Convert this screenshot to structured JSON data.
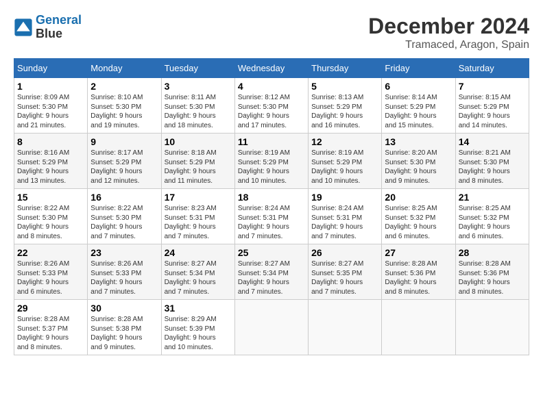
{
  "logo": {
    "line1": "General",
    "line2": "Blue"
  },
  "title": "December 2024",
  "location": "Tramaced, Aragon, Spain",
  "headers": [
    "Sunday",
    "Monday",
    "Tuesday",
    "Wednesday",
    "Thursday",
    "Friday",
    "Saturday"
  ],
  "weeks": [
    [
      {
        "day": "1",
        "info": "Sunrise: 8:09 AM\nSunset: 5:30 PM\nDaylight: 9 hours\nand 21 minutes."
      },
      {
        "day": "2",
        "info": "Sunrise: 8:10 AM\nSunset: 5:30 PM\nDaylight: 9 hours\nand 19 minutes."
      },
      {
        "day": "3",
        "info": "Sunrise: 8:11 AM\nSunset: 5:30 PM\nDaylight: 9 hours\nand 18 minutes."
      },
      {
        "day": "4",
        "info": "Sunrise: 8:12 AM\nSunset: 5:30 PM\nDaylight: 9 hours\nand 17 minutes."
      },
      {
        "day": "5",
        "info": "Sunrise: 8:13 AM\nSunset: 5:29 PM\nDaylight: 9 hours\nand 16 minutes."
      },
      {
        "day": "6",
        "info": "Sunrise: 8:14 AM\nSunset: 5:29 PM\nDaylight: 9 hours\nand 15 minutes."
      },
      {
        "day": "7",
        "info": "Sunrise: 8:15 AM\nSunset: 5:29 PM\nDaylight: 9 hours\nand 14 minutes."
      }
    ],
    [
      {
        "day": "8",
        "info": "Sunrise: 8:16 AM\nSunset: 5:29 PM\nDaylight: 9 hours\nand 13 minutes."
      },
      {
        "day": "9",
        "info": "Sunrise: 8:17 AM\nSunset: 5:29 PM\nDaylight: 9 hours\nand 12 minutes."
      },
      {
        "day": "10",
        "info": "Sunrise: 8:18 AM\nSunset: 5:29 PM\nDaylight: 9 hours\nand 11 minutes."
      },
      {
        "day": "11",
        "info": "Sunrise: 8:19 AM\nSunset: 5:29 PM\nDaylight: 9 hours\nand 10 minutes."
      },
      {
        "day": "12",
        "info": "Sunrise: 8:19 AM\nSunset: 5:29 PM\nDaylight: 9 hours\nand 10 minutes."
      },
      {
        "day": "13",
        "info": "Sunrise: 8:20 AM\nSunset: 5:30 PM\nDaylight: 9 hours\nand 9 minutes."
      },
      {
        "day": "14",
        "info": "Sunrise: 8:21 AM\nSunset: 5:30 PM\nDaylight: 9 hours\nand 8 minutes."
      }
    ],
    [
      {
        "day": "15",
        "info": "Sunrise: 8:22 AM\nSunset: 5:30 PM\nDaylight: 9 hours\nand 8 minutes."
      },
      {
        "day": "16",
        "info": "Sunrise: 8:22 AM\nSunset: 5:30 PM\nDaylight: 9 hours\nand 7 minutes."
      },
      {
        "day": "17",
        "info": "Sunrise: 8:23 AM\nSunset: 5:31 PM\nDaylight: 9 hours\nand 7 minutes."
      },
      {
        "day": "18",
        "info": "Sunrise: 8:24 AM\nSunset: 5:31 PM\nDaylight: 9 hours\nand 7 minutes."
      },
      {
        "day": "19",
        "info": "Sunrise: 8:24 AM\nSunset: 5:31 PM\nDaylight: 9 hours\nand 7 minutes."
      },
      {
        "day": "20",
        "info": "Sunrise: 8:25 AM\nSunset: 5:32 PM\nDaylight: 9 hours\nand 6 minutes."
      },
      {
        "day": "21",
        "info": "Sunrise: 8:25 AM\nSunset: 5:32 PM\nDaylight: 9 hours\nand 6 minutes."
      }
    ],
    [
      {
        "day": "22",
        "info": "Sunrise: 8:26 AM\nSunset: 5:33 PM\nDaylight: 9 hours\nand 6 minutes."
      },
      {
        "day": "23",
        "info": "Sunrise: 8:26 AM\nSunset: 5:33 PM\nDaylight: 9 hours\nand 7 minutes."
      },
      {
        "day": "24",
        "info": "Sunrise: 8:27 AM\nSunset: 5:34 PM\nDaylight: 9 hours\nand 7 minutes."
      },
      {
        "day": "25",
        "info": "Sunrise: 8:27 AM\nSunset: 5:34 PM\nDaylight: 9 hours\nand 7 minutes."
      },
      {
        "day": "26",
        "info": "Sunrise: 8:27 AM\nSunset: 5:35 PM\nDaylight: 9 hours\nand 7 minutes."
      },
      {
        "day": "27",
        "info": "Sunrise: 8:28 AM\nSunset: 5:36 PM\nDaylight: 9 hours\nand 8 minutes."
      },
      {
        "day": "28",
        "info": "Sunrise: 8:28 AM\nSunset: 5:36 PM\nDaylight: 9 hours\nand 8 minutes."
      }
    ],
    [
      {
        "day": "29",
        "info": "Sunrise: 8:28 AM\nSunset: 5:37 PM\nDaylight: 9 hours\nand 8 minutes."
      },
      {
        "day": "30",
        "info": "Sunrise: 8:28 AM\nSunset: 5:38 PM\nDaylight: 9 hours\nand 9 minutes."
      },
      {
        "day": "31",
        "info": "Sunrise: 8:29 AM\nSunset: 5:39 PM\nDaylight: 9 hours\nand 10 minutes."
      },
      null,
      null,
      null,
      null
    ]
  ]
}
